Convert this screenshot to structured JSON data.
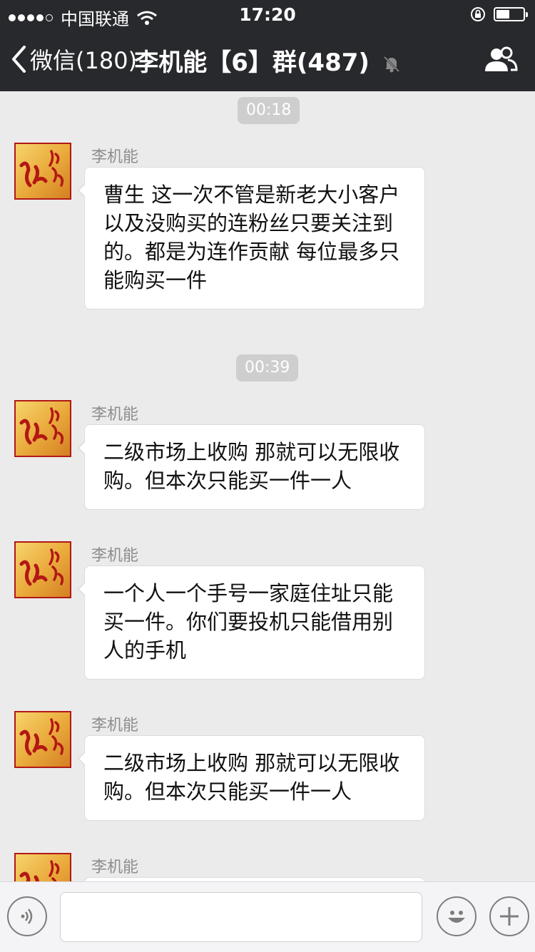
{
  "status_bar": {
    "carrier": "中国联通",
    "time": "17:20"
  },
  "nav": {
    "back_label": "微信(180)",
    "title": "李机能【6】群(487)"
  },
  "messages": [
    {
      "type": "time",
      "text": "00:18"
    },
    {
      "type": "message",
      "sender": "李机能",
      "text": "曹生 这一次不管是新老大小客户以及没购买的连粉丝只要关注到的。都是为连作贡献 每位最多只能购买一件"
    },
    {
      "type": "time",
      "text": "00:39"
    },
    {
      "type": "message",
      "sender": "李机能",
      "text": "二级市场上收购 那就可以无限收购。但本次只能买一件一人"
    },
    {
      "type": "message",
      "sender": "李机能",
      "text": "一个人一个手号一家庭住址只能买一件。你们要投机只能借用别人的手机"
    },
    {
      "type": "message",
      "sender": "李机能",
      "text": "二级市场上收购 那就可以无限收购。但本次只能买一件一人"
    },
    {
      "type": "message",
      "sender": "李机能",
      "text": ""
    }
  ],
  "input_bar": {
    "message_value": "",
    "icons": [
      "voice-icon",
      "emoji-icon",
      "plus-icon"
    ]
  },
  "colors": {
    "header_bg": "#28292d",
    "chat_bg": "#ebebeb",
    "avatar_red": "#b21814"
  }
}
